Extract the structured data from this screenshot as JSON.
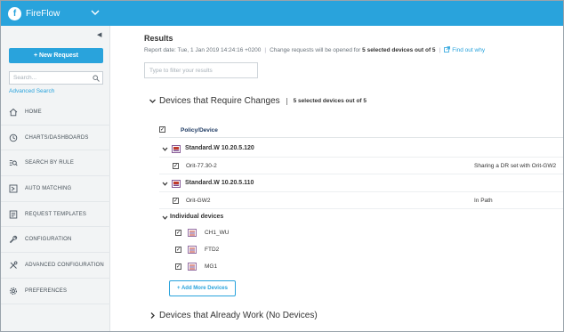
{
  "header": {
    "app_name": "FireFlow",
    "logo_letter": "f"
  },
  "sidebar": {
    "new_request_label": "+ New Request",
    "search_placeholder": "Search...",
    "advanced_search_label": "Advanced Search",
    "items": [
      {
        "label": "HOME",
        "icon": "home-icon"
      },
      {
        "label": "CHARTS/DASHBOARDS",
        "icon": "clock-chart-icon"
      },
      {
        "label": "SEARCH BY RULE",
        "icon": "rule-search-icon"
      },
      {
        "label": "AUTO MATCHING",
        "icon": "auto-matching-icon"
      },
      {
        "label": "REQUEST TEMPLATES",
        "icon": "template-icon"
      },
      {
        "label": "CONFIGURATION",
        "icon": "wrench-icon"
      },
      {
        "label": "ADVANCED CONFIGURATION",
        "icon": "tools-icon"
      },
      {
        "label": "PREFERENCES",
        "icon": "gear-icon"
      }
    ]
  },
  "results": {
    "title": "Results",
    "report_date": "Report date: Tue, 1 Jan 2019 14:24:16 +0200",
    "change_note_prefix": "Change requests will be opened for",
    "change_note_bold": "5 selected devices out of 5",
    "find_out_why": "Find out why",
    "filter_placeholder": "Type to filter your results"
  },
  "require_changes": {
    "title": "Devices that Require Changes",
    "count_label": "5 selected devices out of 5",
    "column_header": "Policy/Device",
    "groups": [
      {
        "name": "Standard.W 10.20.5.120",
        "devices": [
          {
            "name": "Orit-77.30-2",
            "reason": "Sharing a DR set with Orit-GW2"
          }
        ]
      },
      {
        "name": "Standard.W 10.20.5.110",
        "devices": [
          {
            "name": "Orit-GW2",
            "reason": "In Path"
          }
        ]
      },
      {
        "name": "Individual devices",
        "devices": [
          {
            "name": "CH1_WU"
          },
          {
            "name": "FTD2"
          },
          {
            "name": "MG1"
          }
        ]
      }
    ],
    "add_more_label": "+ Add More Devices"
  },
  "already_work": {
    "title": "Devices that Already Work (No Devices)"
  },
  "colors": {
    "brand_blue": "#29a3dc",
    "nav_bg": "#f2f4f5",
    "header_text": "#1f3b63"
  }
}
